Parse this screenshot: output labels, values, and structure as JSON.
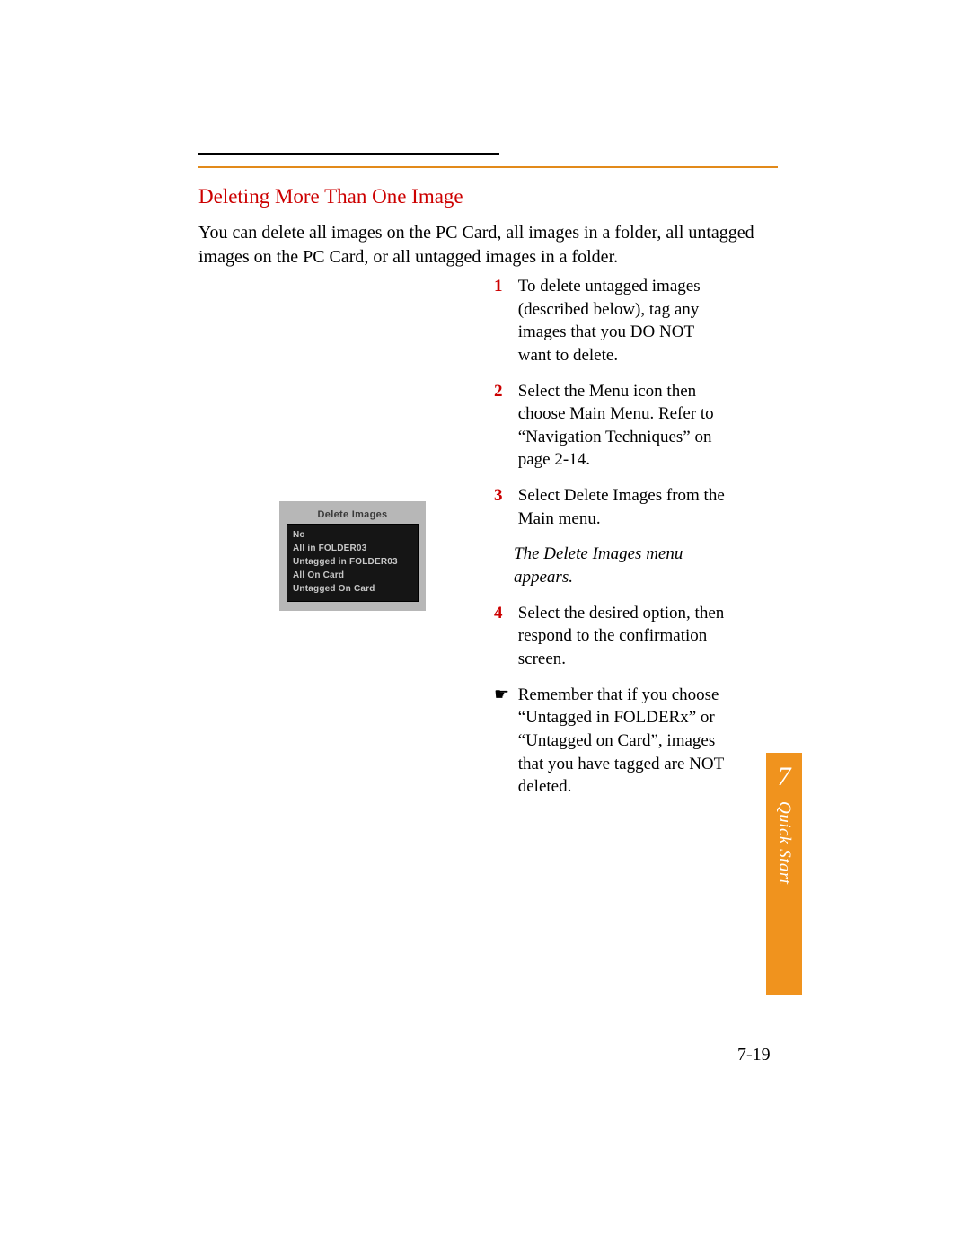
{
  "section_title": "Deleting More Than One Image",
  "intro": "You can delete all images on the PC Card, all images in a folder, all untagged images on the PC Card, or all untagged images in a folder.",
  "steps": {
    "s1_num": "1",
    "s1": "To delete untagged images (described below), tag any images that you DO NOT want to delete.",
    "s2_num": "2",
    "s2": "Select the Menu icon then choose Main Menu. Refer to “Navigation Techniques” on page 2-14.",
    "s3_num": "3",
    "s3": "Select Delete Images from the Main menu.",
    "note": "The Delete Images menu appears.",
    "s4_num": "4",
    "s4": "Select the desired option, then respond to the confirmation screen.",
    "pointer_symbol": "☛",
    "pointer": "Remember that if you choose “Untagged in FOLDERx” or “Untagged on Card”, images that you have tagged are NOT deleted."
  },
  "figure": {
    "title": "Delete Images",
    "items": [
      "No",
      "All in FOLDER03",
      "Untagged in FOLDER03",
      "All On Card",
      "Untagged On Card"
    ]
  },
  "tab": {
    "num": "7",
    "label": "Quick Start"
  },
  "page_number": "7-19"
}
